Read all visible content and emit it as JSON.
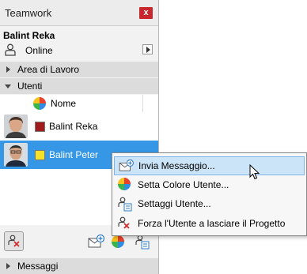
{
  "window": {
    "title": "Teamwork",
    "close_label": "x"
  },
  "user": {
    "name": "Balint Reka",
    "status": "Online"
  },
  "sections": {
    "workspace": "Area di Lavoro",
    "users": "Utenti",
    "messages": "Messaggi"
  },
  "users_list": {
    "column_header": "Nome",
    "rows": [
      {
        "name": "Balint Reka",
        "color": "#a01c1c",
        "selected": false
      },
      {
        "name": "Balint Peter",
        "color": "#f5e02a",
        "selected": true
      }
    ]
  },
  "context_menu": {
    "items": [
      {
        "label": "Invia Messaggio...",
        "icon": "send-message-icon"
      },
      {
        "label": "Setta Colore Utente...",
        "icon": "color-wheel-icon"
      },
      {
        "label": "Settaggi Utente...",
        "icon": "user-settings-icon"
      },
      {
        "label": "Forza l'Utente a lasciare il Progetto",
        "icon": "kick-user-icon"
      }
    ]
  },
  "colors": {
    "selection": "#3597e6",
    "menu_highlight": "#cce4f7",
    "close_button": "#c8282d"
  }
}
